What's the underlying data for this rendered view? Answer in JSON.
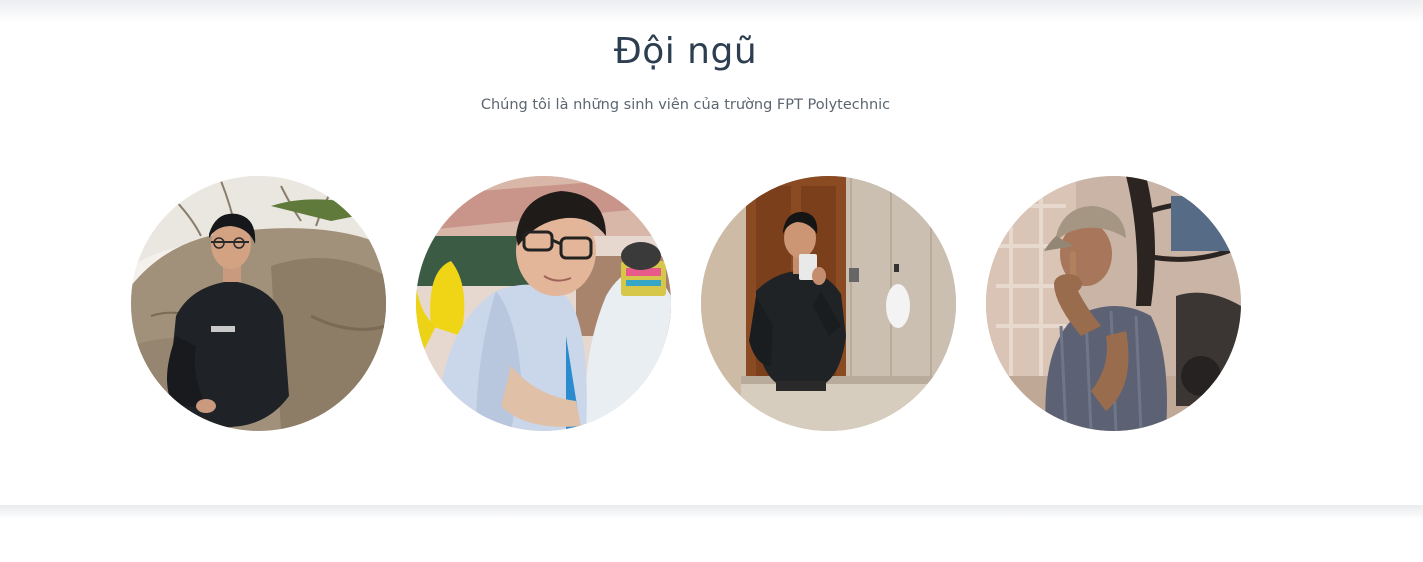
{
  "team": {
    "title": "Đội ngũ",
    "subtitle": "Chúng tôi là những sinh viên của trường FPT Polytechnic",
    "members": [
      {
        "photo": "member-photo-1"
      },
      {
        "photo": "member-photo-2"
      },
      {
        "photo": "member-photo-3"
      },
      {
        "photo": "member-photo-4"
      }
    ]
  },
  "colors": {
    "title": "#2c3e50",
    "subtitle": "#5c6670",
    "background": "#ffffff"
  }
}
